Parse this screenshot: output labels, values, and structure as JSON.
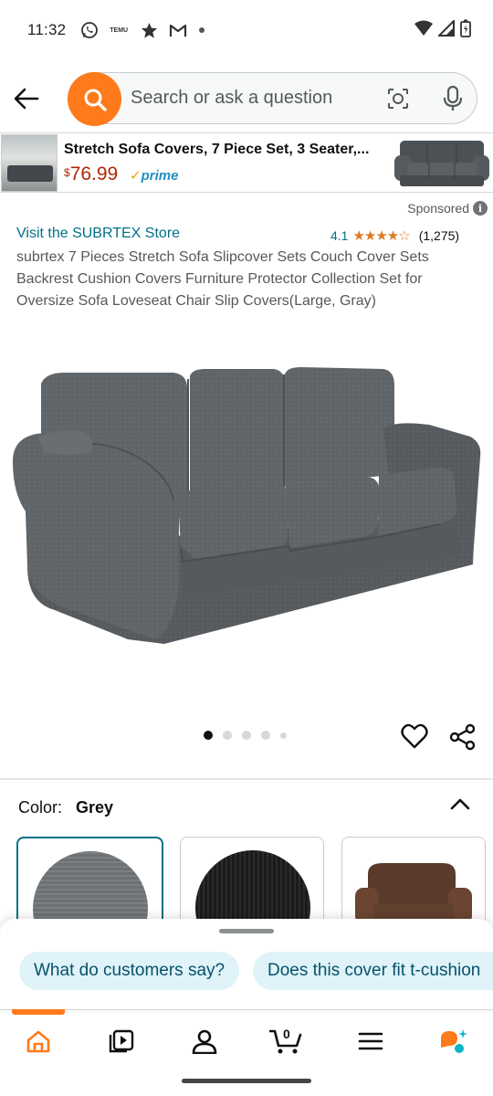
{
  "status_bar": {
    "time": "11:32",
    "icons": [
      "whatsapp-icon",
      "temu-icon",
      "star-icon",
      "gmail-icon",
      "dot-icon"
    ],
    "temu_text": "TEMU",
    "right_icons": [
      "wifi-icon",
      "signal-icon",
      "battery-icon"
    ]
  },
  "search": {
    "placeholder": "Search or ask a question"
  },
  "ad": {
    "title": "Stretch Sofa Covers, 7 Piece Set, 3 Seater,...",
    "price_currency": "$",
    "price_amount": "76.99",
    "prime_label": "prime"
  },
  "sponsored_label": "Sponsored",
  "product": {
    "store_link": "Visit the SUBRTEX Store",
    "rating": "4.1",
    "stars": "★★★★☆",
    "review_count": "(1,275)",
    "title": "subrtex 7 Pieces Stretch Sofa Slipcover Sets Couch Cover Sets Backrest Cushion Covers Furniture Protector Collection Set for Oversize Sofa Loveseat Chair Slip Covers(Large, Gray)",
    "image_count": 5,
    "active_image": 1
  },
  "color": {
    "label": "Color:",
    "value": "Grey",
    "swatches": [
      {
        "name": "Grey",
        "color": "#6d7174",
        "selected": true
      },
      {
        "name": "Black",
        "color": "#1b1b1b",
        "selected": false
      },
      {
        "name": "Brown",
        "color": "#5a3a2a",
        "selected": false
      }
    ]
  },
  "suggestions": [
    "What do customers say?",
    "Does this cover fit t-cushion"
  ],
  "bottom_nav": {
    "items": [
      "home-icon",
      "video-icon",
      "account-icon",
      "cart-icon",
      "menu-icon",
      "rufus-icon"
    ],
    "cart_count": "0"
  },
  "colors": {
    "brand_orange": "#ff7a1a",
    "link_teal": "#007185",
    "price_red": "#b12704",
    "star_orange": "#de7921",
    "sofa_grey": "#5f6468"
  }
}
